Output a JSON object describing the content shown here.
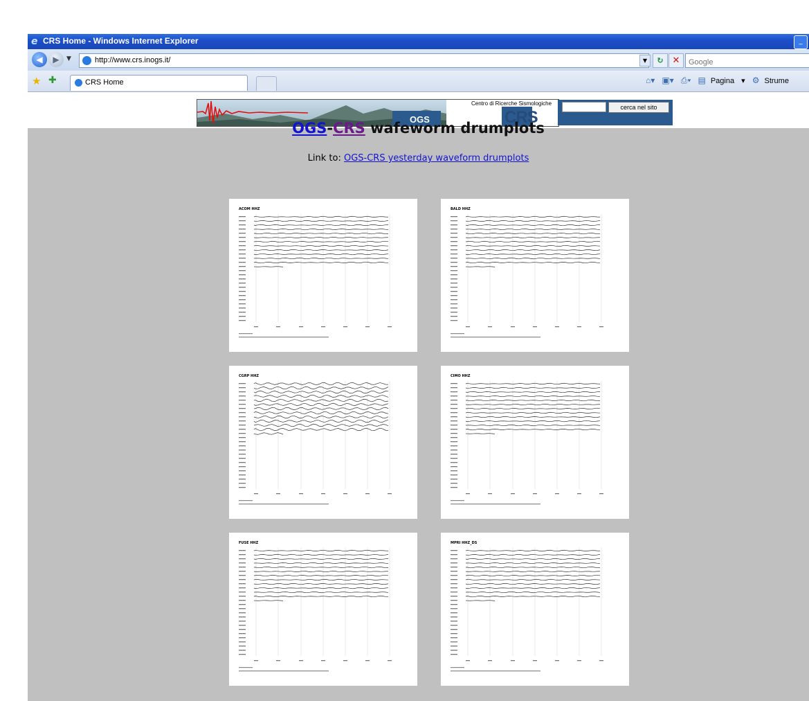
{
  "window": {
    "title": "CRS Home - Windows Internet Explorer"
  },
  "addressbar": {
    "url": "http://www.crs.inogs.it/",
    "search_placeholder": "Google"
  },
  "tabs": [
    {
      "label": "CRS Home"
    }
  ],
  "toolbar": {
    "page_label": "Pagina",
    "tools_label": "Strume"
  },
  "header": {
    "banner_subtitle": "Centro di Ricerche Sismologiche",
    "banner_logo_crs": "CRS",
    "banner_logo_ogs": "OGS",
    "site_search_button": "cerca nel sito"
  },
  "page": {
    "title_ogs": "OGS",
    "title_sep": "-",
    "title_crs": "CRS",
    "title_rest": " wafeworm drumplots",
    "link_prefix": "Link to: ",
    "link_text": "OGS-CRS yesterday waveform drumplots"
  },
  "drumplots": [
    {
      "station": "ACOM HHZ",
      "traces": 13
    },
    {
      "station": "BALD HHZ",
      "traces": 13
    },
    {
      "station": "CGRP HHZ",
      "traces": 13
    },
    {
      "station": "CIMO HHZ",
      "traces": 13
    },
    {
      "station": "FUSE HHZ",
      "traces": 13
    },
    {
      "station": "MPRI HHZ_DS",
      "traces": 13
    }
  ]
}
